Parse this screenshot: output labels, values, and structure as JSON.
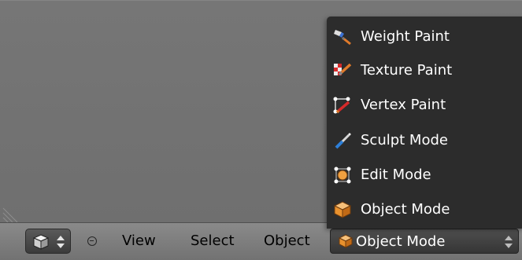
{
  "dropdown": {
    "items": [
      {
        "label": "Weight Paint",
        "icon": "weight-paint-icon"
      },
      {
        "label": "Texture Paint",
        "icon": "texture-paint-icon"
      },
      {
        "label": "Vertex Paint",
        "icon": "vertex-paint-icon"
      },
      {
        "label": "Sculpt Mode",
        "icon": "sculpt-mode-icon"
      },
      {
        "label": "Edit Mode",
        "icon": "edit-mode-icon"
      },
      {
        "label": "Object Mode",
        "icon": "object-mode-icon"
      }
    ]
  },
  "header": {
    "menus": [
      "View",
      "Select",
      "Object"
    ],
    "mode_select": {
      "value": "Object Mode",
      "icon": "object-mode-icon"
    },
    "editor_type_icon": "3d-view-cube-icon"
  },
  "colors": {
    "viewport_bg": "#727272",
    "menu_bg": "#2c2c2c",
    "menu_text": "#ffffff",
    "header_text": "#000000",
    "cube_orange": "#e8912e"
  }
}
